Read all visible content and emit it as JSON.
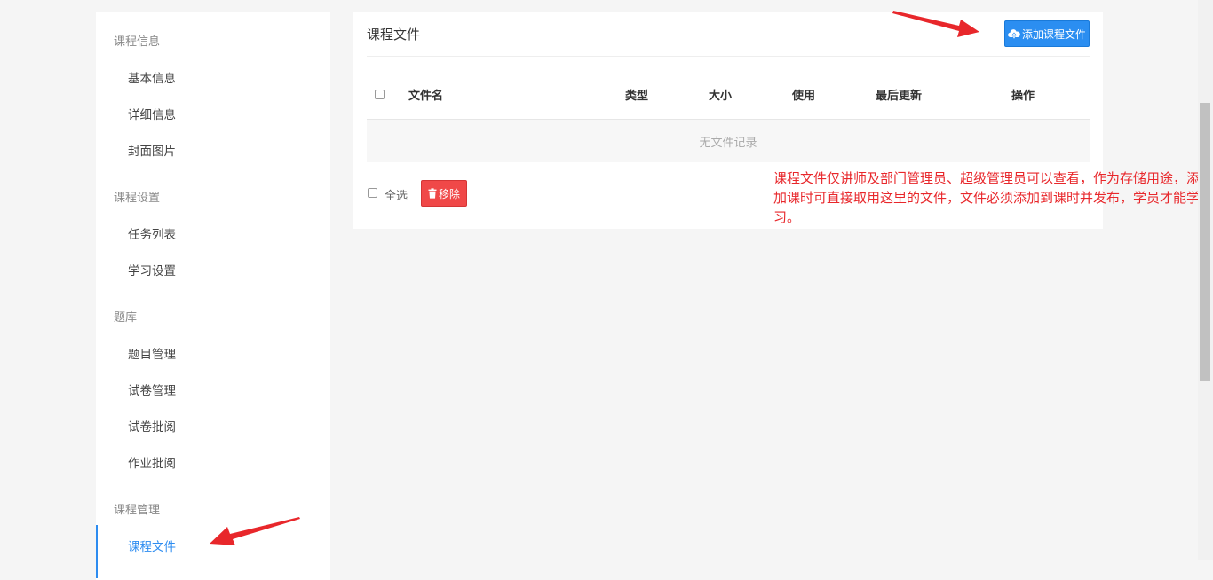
{
  "sidebar": {
    "groups": [
      {
        "label": "课程信息",
        "items": [
          "基本信息",
          "详细信息",
          "封面图片"
        ]
      },
      {
        "label": "课程设置",
        "items": [
          "任务列表",
          "学习设置"
        ]
      },
      {
        "label": "题库",
        "items": [
          "题目管理",
          "试卷管理",
          "试卷批阅",
          "作业批阅"
        ]
      },
      {
        "label": "课程管理",
        "items": [
          "课程文件"
        ]
      }
    ],
    "active_item": "课程文件"
  },
  "panel": {
    "title": "课程文件",
    "add_button_label": "添加课程文件",
    "table": {
      "headers": [
        "文件名",
        "类型",
        "大小",
        "使用",
        "最后更新",
        "操作"
      ],
      "empty_text": "无文件记录"
    },
    "select_all_label": "全选",
    "remove_button_label": "移除"
  },
  "annotation": {
    "note": "课程文件仅讲师及部门管理员、超级管理员可以查看，作为存储用途，添加课时可直接取用这里的文件，文件必须添加到课时并发布，学员才能学习。",
    "color": "#e8272b"
  },
  "colors": {
    "primary": "#2b8ef1",
    "danger": "#f04848",
    "active": "#2d8cf0"
  }
}
